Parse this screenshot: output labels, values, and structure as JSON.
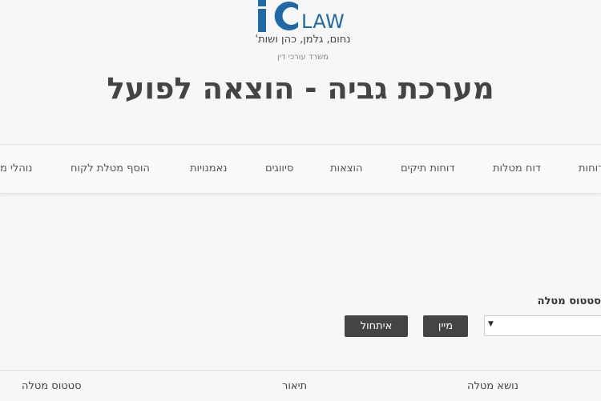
{
  "logo": {
    "brand": "LAW",
    "names": "נחום, גלמן, כהן ושות'",
    "subtitle": "משרד עורכי דין"
  },
  "page_title": "מערכת גביה - הוצאה לפועל",
  "nav": {
    "items": [
      {
        "label": "דוחות",
        "name": "nav-reports"
      },
      {
        "label": "דוח מטלות",
        "name": "nav-tasks-report"
      },
      {
        "label": "דוחות תיקים",
        "name": "nav-case-reports"
      },
      {
        "label": "הוצאות",
        "name": "nav-expenses"
      },
      {
        "label": "סיווגים",
        "name": "nav-classifications"
      },
      {
        "label": "נאמנויות",
        "name": "nav-trusts"
      },
      {
        "label": "הוסף מטלת לקוח",
        "name": "nav-add-client-task"
      },
      {
        "label": "נוהלי מ",
        "name": "nav-procedures"
      }
    ]
  },
  "filter": {
    "label": "סטטוס מטלה",
    "select_value": "",
    "sort_label": "מיין",
    "reset_label": "איתחול"
  },
  "table": {
    "columns": [
      "נושא מטלה",
      "תיאור",
      "סטטוס מטלה"
    ]
  },
  "colors": {
    "brand_blue": "#1f6aa6",
    "button_dark": "#444444",
    "background": "#f7f7f7"
  }
}
